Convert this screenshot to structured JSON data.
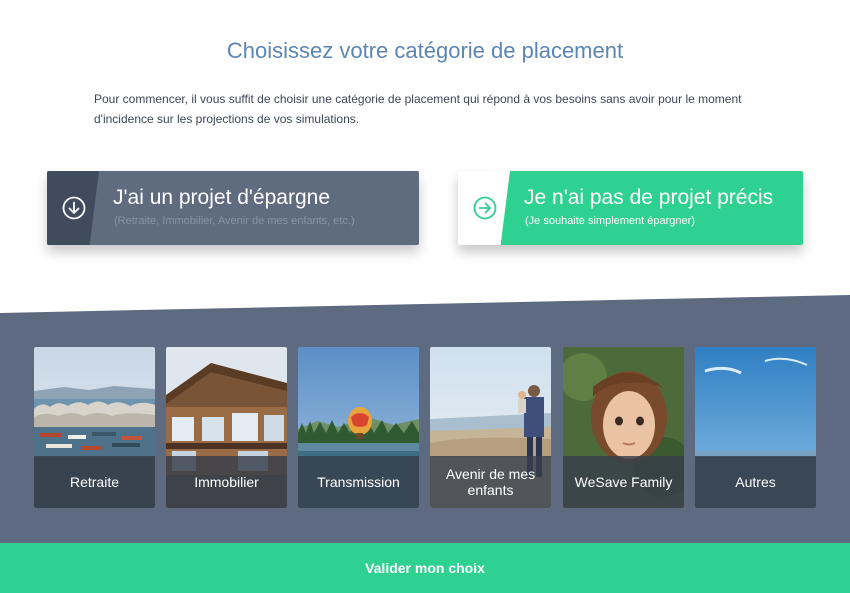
{
  "page": {
    "title": "Choisissez votre catégorie de placement",
    "intro": "Pour commencer, il vous suffit de choisir une catégorie de placement qui répond à vos besoins sans avoir pour le moment d'incidence sur les projections de vos simulations."
  },
  "choices": {
    "saving_project": {
      "title": "J'ai un projet d'épargne",
      "subtitle": "(Retraite, Immobilier, Avenir de mes enfants, etc.)",
      "icon": "arrow-down-circle-icon"
    },
    "no_project": {
      "title": "Je n'ai pas de projet précis",
      "subtitle": "(Je souhaite simplement épargner)",
      "icon": "arrow-right-circle-icon"
    }
  },
  "categories": [
    {
      "label": "Retraite",
      "image": "harbor-boats-photo"
    },
    {
      "label": "Immobilier",
      "image": "wooden-house-photo"
    },
    {
      "label": "Transmission",
      "image": "hot-air-balloon-lake-photo"
    },
    {
      "label": "Avenir de mes enfants",
      "image": "father-child-beach-photo"
    },
    {
      "label": "WeSave Family",
      "image": "young-girl-portrait-photo"
    },
    {
      "label": "Autres",
      "image": "blue-sky-photo"
    }
  ],
  "footer": {
    "validate_label": "Valider mon choix"
  },
  "colors": {
    "accent_green": "#2ed190",
    "slate": "#5e6a80",
    "dark_slate": "#404b5d",
    "title_blue": "#5b86b3"
  }
}
